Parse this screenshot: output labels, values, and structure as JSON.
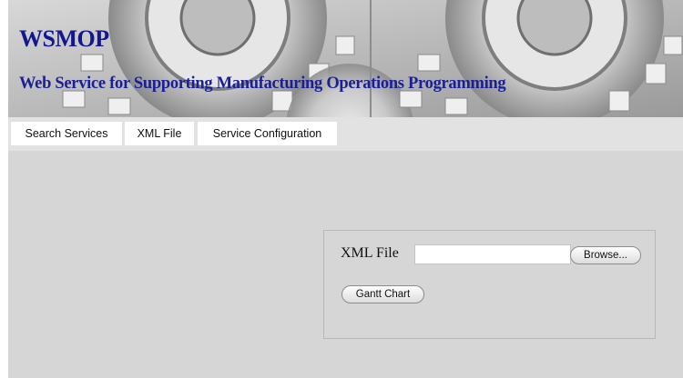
{
  "header": {
    "title": "WSMOP",
    "subtitle": "Web Service for Supporting Manufacturing Operations Programming"
  },
  "nav": {
    "tabs": [
      {
        "label": "Search Services"
      },
      {
        "label": "XML File"
      },
      {
        "label": "Service Configuration"
      }
    ]
  },
  "form": {
    "file_label": "XML File",
    "file_value": "",
    "browse_label": "Browse...",
    "gantt_label": "Gantt Chart"
  },
  "colors": {
    "title_text": "#13168f",
    "content_bg": "#d6d6d6",
    "nav_bg": "#e2e2e2"
  },
  "icons": {
    "banner_art": "gears-image"
  }
}
